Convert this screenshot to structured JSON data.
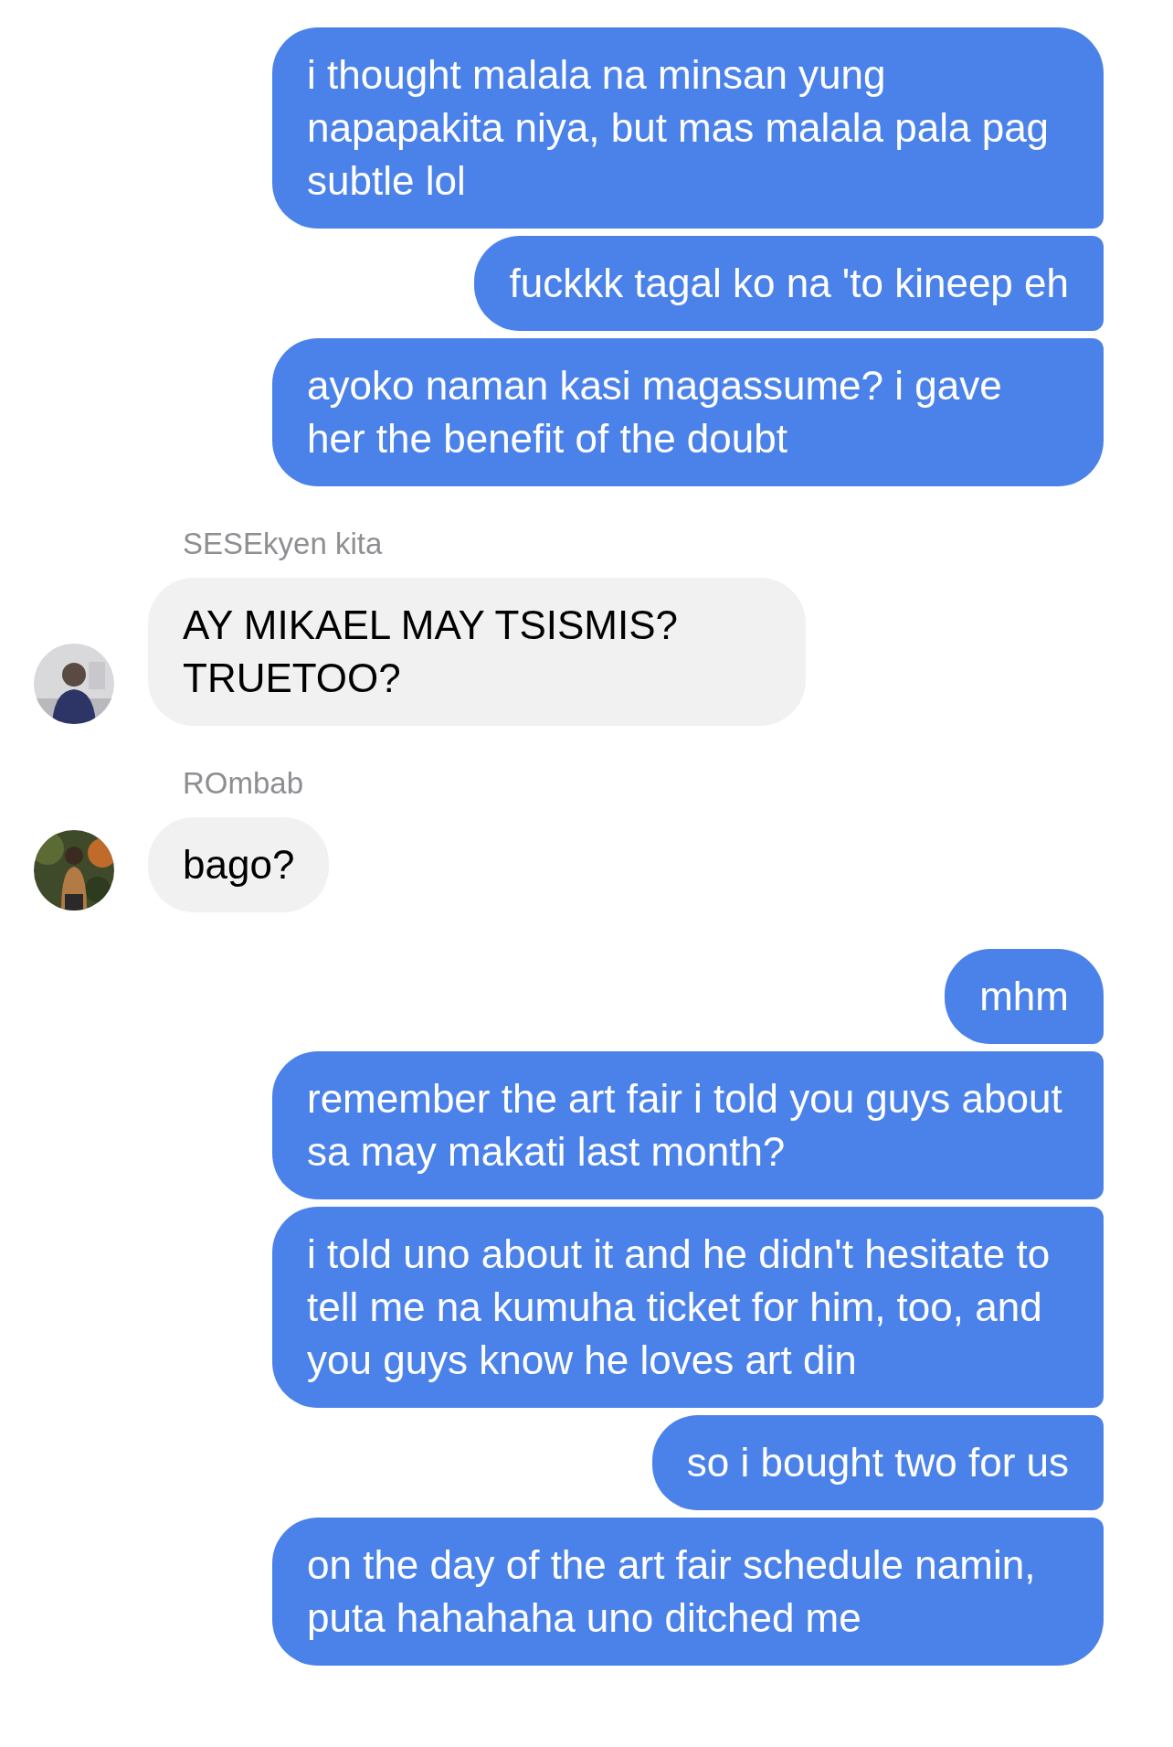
{
  "messages": [
    {
      "kind": "outgoing",
      "text": "i thought malala na minsan yung napapakita niya, but mas malala pala pag subtle lol"
    },
    {
      "kind": "outgoing",
      "text": "fuckkk tagal ko na 'to kineep eh"
    },
    {
      "kind": "outgoing",
      "text": "ayoko naman kasi magassume? i gave her the benefit of the doubt"
    },
    {
      "kind": "incoming",
      "sender": "SESEkyen kita",
      "text": "AY MIKAEL MAY TSISMIS? TRUETOO?"
    },
    {
      "kind": "incoming",
      "sender": "ROmbab",
      "text": "bago?"
    },
    {
      "kind": "outgoing",
      "text": "mhm"
    },
    {
      "kind": "outgoing",
      "text": "remember the art fair i told you guys about sa may makati last month?"
    },
    {
      "kind": "outgoing",
      "text": "i told uno about it and he didn't hesitate to tell me na kumuha ticket for him, too, and you guys know he loves art din"
    },
    {
      "kind": "outgoing",
      "text": "so i bought two for us"
    },
    {
      "kind": "outgoing",
      "text": "on the day of the art fair schedule namin, puta hahahaha uno ditched me"
    }
  ]
}
